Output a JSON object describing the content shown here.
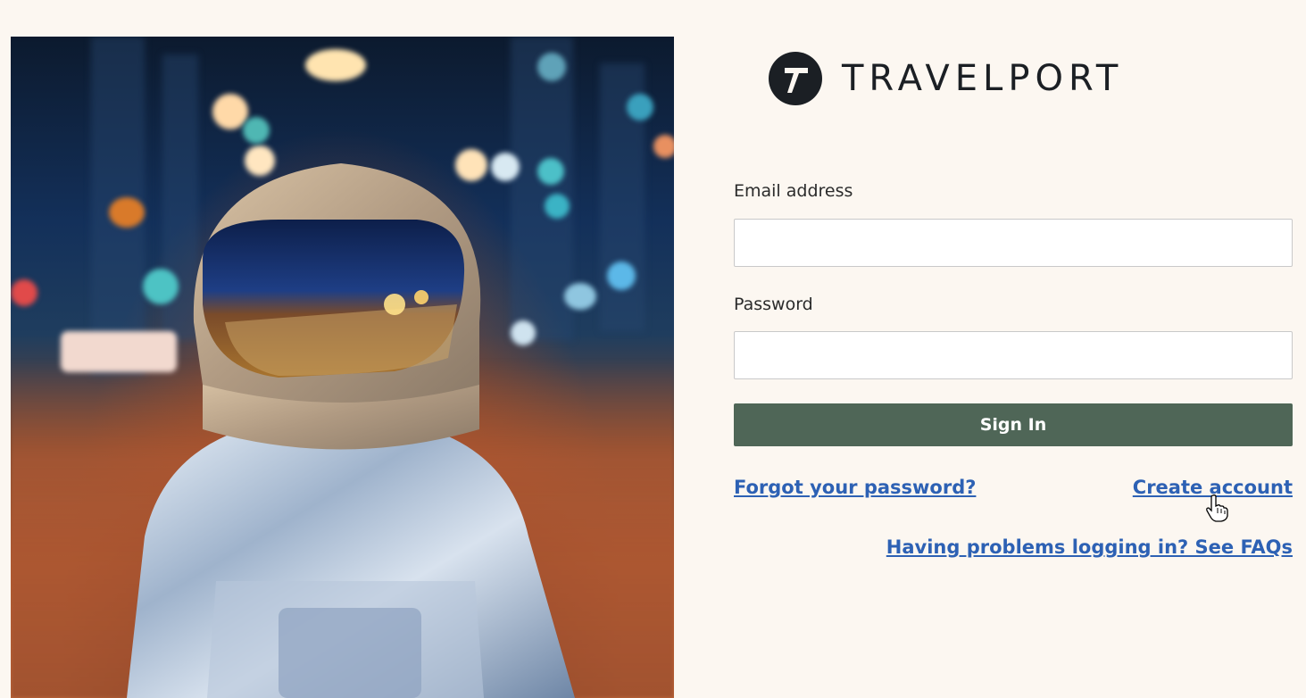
{
  "brand": {
    "name": "TRAVELPORT",
    "logo_icon": "travelport-t-icon",
    "text_color": "#1b1f24"
  },
  "hero": {
    "image_description_icon": "astronaut-city-night-image"
  },
  "form": {
    "email_label": "Email address",
    "email_value": "",
    "password_label": "Password",
    "password_value": "",
    "sign_in_label": "Sign In",
    "button_color": "#4f6657"
  },
  "links": {
    "forgot_password": "Forgot your password?",
    "create_account": "Create account",
    "faq": "Having problems logging in? See FAQs",
    "link_color": "#2d61b4"
  },
  "background_color": "#fcf7f1"
}
